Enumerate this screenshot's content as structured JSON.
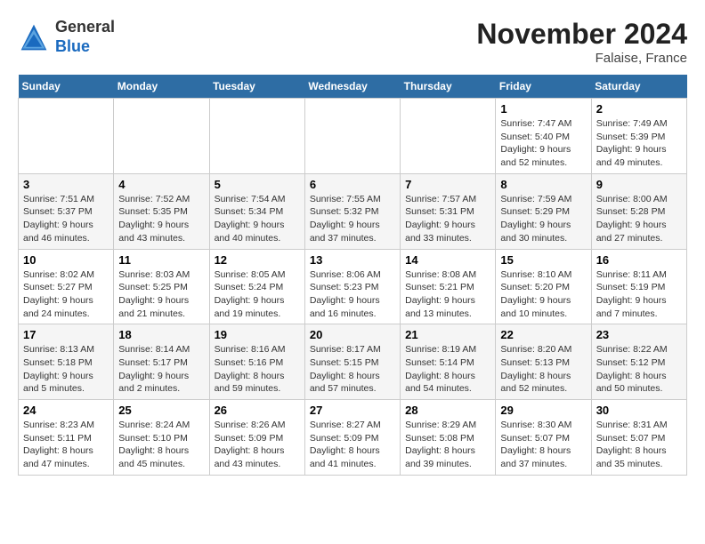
{
  "logo": {
    "line1": "General",
    "line2": "Blue"
  },
  "title": "November 2024",
  "subtitle": "Falaise, France",
  "headers": [
    "Sunday",
    "Monday",
    "Tuesday",
    "Wednesday",
    "Thursday",
    "Friday",
    "Saturday"
  ],
  "rows": [
    [
      {
        "num": "",
        "sunrise": "",
        "sunset": "",
        "daylight": ""
      },
      {
        "num": "",
        "sunrise": "",
        "sunset": "",
        "daylight": ""
      },
      {
        "num": "",
        "sunrise": "",
        "sunset": "",
        "daylight": ""
      },
      {
        "num": "",
        "sunrise": "",
        "sunset": "",
        "daylight": ""
      },
      {
        "num": "",
        "sunrise": "",
        "sunset": "",
        "daylight": ""
      },
      {
        "num": "1",
        "sunrise": "Sunrise: 7:47 AM",
        "sunset": "Sunset: 5:40 PM",
        "daylight": "Daylight: 9 hours and 52 minutes."
      },
      {
        "num": "2",
        "sunrise": "Sunrise: 7:49 AM",
        "sunset": "Sunset: 5:39 PM",
        "daylight": "Daylight: 9 hours and 49 minutes."
      }
    ],
    [
      {
        "num": "3",
        "sunrise": "Sunrise: 7:51 AM",
        "sunset": "Sunset: 5:37 PM",
        "daylight": "Daylight: 9 hours and 46 minutes."
      },
      {
        "num": "4",
        "sunrise": "Sunrise: 7:52 AM",
        "sunset": "Sunset: 5:35 PM",
        "daylight": "Daylight: 9 hours and 43 minutes."
      },
      {
        "num": "5",
        "sunrise": "Sunrise: 7:54 AM",
        "sunset": "Sunset: 5:34 PM",
        "daylight": "Daylight: 9 hours and 40 minutes."
      },
      {
        "num": "6",
        "sunrise": "Sunrise: 7:55 AM",
        "sunset": "Sunset: 5:32 PM",
        "daylight": "Daylight: 9 hours and 37 minutes."
      },
      {
        "num": "7",
        "sunrise": "Sunrise: 7:57 AM",
        "sunset": "Sunset: 5:31 PM",
        "daylight": "Daylight: 9 hours and 33 minutes."
      },
      {
        "num": "8",
        "sunrise": "Sunrise: 7:59 AM",
        "sunset": "Sunset: 5:29 PM",
        "daylight": "Daylight: 9 hours and 30 minutes."
      },
      {
        "num": "9",
        "sunrise": "Sunrise: 8:00 AM",
        "sunset": "Sunset: 5:28 PM",
        "daylight": "Daylight: 9 hours and 27 minutes."
      }
    ],
    [
      {
        "num": "10",
        "sunrise": "Sunrise: 8:02 AM",
        "sunset": "Sunset: 5:27 PM",
        "daylight": "Daylight: 9 hours and 24 minutes."
      },
      {
        "num": "11",
        "sunrise": "Sunrise: 8:03 AM",
        "sunset": "Sunset: 5:25 PM",
        "daylight": "Daylight: 9 hours and 21 minutes."
      },
      {
        "num": "12",
        "sunrise": "Sunrise: 8:05 AM",
        "sunset": "Sunset: 5:24 PM",
        "daylight": "Daylight: 9 hours and 19 minutes."
      },
      {
        "num": "13",
        "sunrise": "Sunrise: 8:06 AM",
        "sunset": "Sunset: 5:23 PM",
        "daylight": "Daylight: 9 hours and 16 minutes."
      },
      {
        "num": "14",
        "sunrise": "Sunrise: 8:08 AM",
        "sunset": "Sunset: 5:21 PM",
        "daylight": "Daylight: 9 hours and 13 minutes."
      },
      {
        "num": "15",
        "sunrise": "Sunrise: 8:10 AM",
        "sunset": "Sunset: 5:20 PM",
        "daylight": "Daylight: 9 hours and 10 minutes."
      },
      {
        "num": "16",
        "sunrise": "Sunrise: 8:11 AM",
        "sunset": "Sunset: 5:19 PM",
        "daylight": "Daylight: 9 hours and 7 minutes."
      }
    ],
    [
      {
        "num": "17",
        "sunrise": "Sunrise: 8:13 AM",
        "sunset": "Sunset: 5:18 PM",
        "daylight": "Daylight: 9 hours and 5 minutes."
      },
      {
        "num": "18",
        "sunrise": "Sunrise: 8:14 AM",
        "sunset": "Sunset: 5:17 PM",
        "daylight": "Daylight: 9 hours and 2 minutes."
      },
      {
        "num": "19",
        "sunrise": "Sunrise: 8:16 AM",
        "sunset": "Sunset: 5:16 PM",
        "daylight": "Daylight: 8 hours and 59 minutes."
      },
      {
        "num": "20",
        "sunrise": "Sunrise: 8:17 AM",
        "sunset": "Sunset: 5:15 PM",
        "daylight": "Daylight: 8 hours and 57 minutes."
      },
      {
        "num": "21",
        "sunrise": "Sunrise: 8:19 AM",
        "sunset": "Sunset: 5:14 PM",
        "daylight": "Daylight: 8 hours and 54 minutes."
      },
      {
        "num": "22",
        "sunrise": "Sunrise: 8:20 AM",
        "sunset": "Sunset: 5:13 PM",
        "daylight": "Daylight: 8 hours and 52 minutes."
      },
      {
        "num": "23",
        "sunrise": "Sunrise: 8:22 AM",
        "sunset": "Sunset: 5:12 PM",
        "daylight": "Daylight: 8 hours and 50 minutes."
      }
    ],
    [
      {
        "num": "24",
        "sunrise": "Sunrise: 8:23 AM",
        "sunset": "Sunset: 5:11 PM",
        "daylight": "Daylight: 8 hours and 47 minutes."
      },
      {
        "num": "25",
        "sunrise": "Sunrise: 8:24 AM",
        "sunset": "Sunset: 5:10 PM",
        "daylight": "Daylight: 8 hours and 45 minutes."
      },
      {
        "num": "26",
        "sunrise": "Sunrise: 8:26 AM",
        "sunset": "Sunset: 5:09 PM",
        "daylight": "Daylight: 8 hours and 43 minutes."
      },
      {
        "num": "27",
        "sunrise": "Sunrise: 8:27 AM",
        "sunset": "Sunset: 5:09 PM",
        "daylight": "Daylight: 8 hours and 41 minutes."
      },
      {
        "num": "28",
        "sunrise": "Sunrise: 8:29 AM",
        "sunset": "Sunset: 5:08 PM",
        "daylight": "Daylight: 8 hours and 39 minutes."
      },
      {
        "num": "29",
        "sunrise": "Sunrise: 8:30 AM",
        "sunset": "Sunset: 5:07 PM",
        "daylight": "Daylight: 8 hours and 37 minutes."
      },
      {
        "num": "30",
        "sunrise": "Sunrise: 8:31 AM",
        "sunset": "Sunset: 5:07 PM",
        "daylight": "Daylight: 8 hours and 35 minutes."
      }
    ]
  ]
}
